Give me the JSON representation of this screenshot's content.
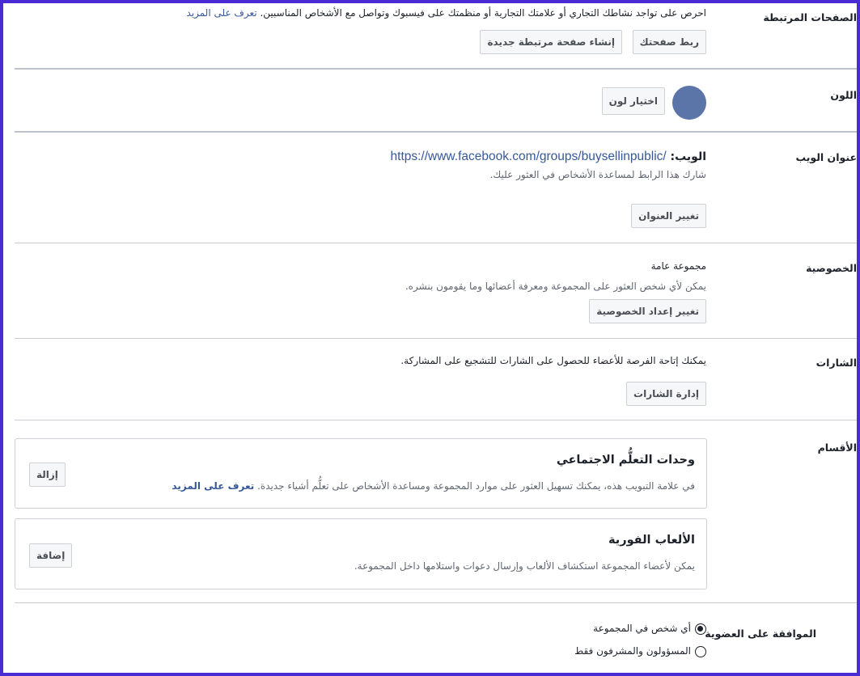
{
  "linked_pages": {
    "label": "الصفحات المرتبطة",
    "description": "احرص على تواجد نشاطك التجاري أو علامتك التجارية أو منظمتك على فيسبوك وتواصل مع الأشخاص المناسبين.",
    "learn_more": "تعرف على المزيد",
    "link_button": "ربط صفحتك",
    "create_button": "إنشاء صفحة مرتبطة جديدة"
  },
  "color": {
    "label": "اللون",
    "swatch_color": "#5b75a8",
    "choose_button": "اختيار لون"
  },
  "web_address": {
    "label": "عنوان الويب",
    "prefix": "الويب:",
    "url": "https://www.facebook.com/groups/buysellinpublic/",
    "hint": "شارك هذا الرابط لمساعدة الأشخاص في العثور عليك.",
    "change_button": "تغيير العنوان"
  },
  "privacy": {
    "label": "الخصوصية",
    "value": "مجموعة عامة",
    "description": "يمكن لأي شخص العثور على المجموعة ومعرفة أعضائها وما يقومون بنشره.",
    "change_button": "تغيير إعداد الخصوصية"
  },
  "badges": {
    "label": "الشارات",
    "description": "يمكنك إتاحة الفرصة للأعضاء للحصول على الشارات للتشجيع على المشاركة.",
    "manage_button": "إدارة الشارات"
  },
  "sections": {
    "label": "الأقسام",
    "items": [
      {
        "title": "وحدات التعلُّم الاجتماعي",
        "description": "في علامة التبويب هذه، يمكنك تسهيل العثور على موارد المجموعة ومساعدة الأشخاص على تعلُّم أشياء جديدة.",
        "learn_more": "تعرف على المزيد",
        "action": "إزالة"
      },
      {
        "title": "الألعاب الفورية",
        "description": "يمكن لأعضاء المجموعة استكشاف الألعاب وإرسال دعوات واستلامها داخل المجموعة.",
        "action": "إضافة"
      }
    ]
  },
  "membership": {
    "label": "الموافقة على العضوية",
    "options": [
      {
        "label": "أي شخص في المجموعة",
        "selected": true
      },
      {
        "label": "المسؤولون والمشرفون فقط",
        "selected": false
      }
    ]
  },
  "colors": {
    "frame_border": "#4a2cd4",
    "link": "#365899"
  }
}
